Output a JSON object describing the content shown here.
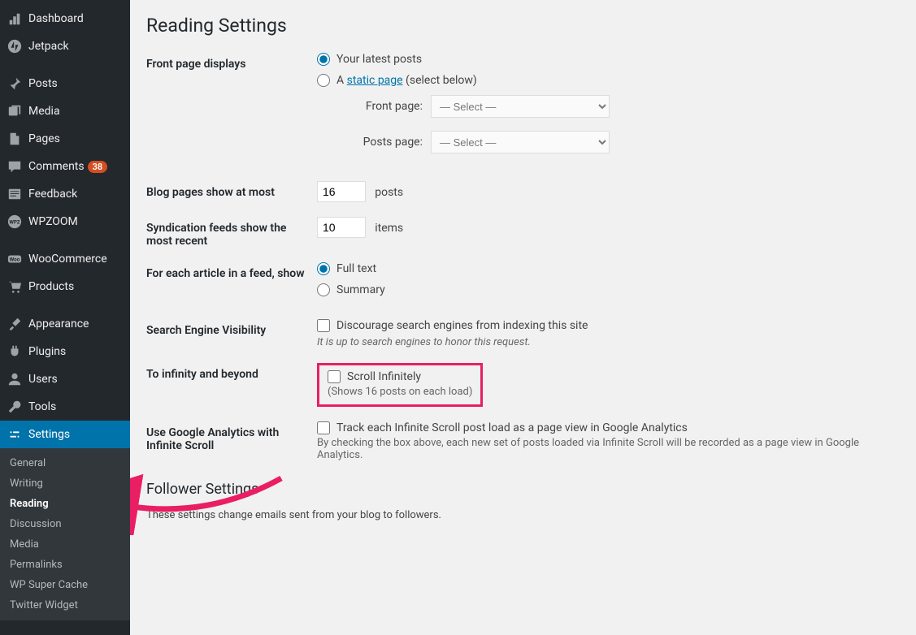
{
  "sidebar": {
    "dashboard": "Dashboard",
    "jetpack": "Jetpack",
    "posts": "Posts",
    "media": "Media",
    "pages": "Pages",
    "comments": "Comments",
    "comments_badge": "38",
    "feedback": "Feedback",
    "wpzoom": "WPZOOM",
    "woocommerce": "WooCommerce",
    "products": "Products",
    "appearance": "Appearance",
    "plugins": "Plugins",
    "users": "Users",
    "tools": "Tools",
    "settings": "Settings"
  },
  "submenu": {
    "general": "General",
    "writing": "Writing",
    "reading": "Reading",
    "discussion": "Discussion",
    "media": "Media",
    "permalinks": "Permalinks",
    "wpsupercache": "WP Super Cache",
    "twitterwidget": "Twitter Widget"
  },
  "page": {
    "title": "Reading Settings",
    "front_page_displays_label": "Front page displays",
    "your_latest_posts": "Your latest posts",
    "a_prefix": "A ",
    "static_page_link": "static page",
    "select_below": " (select below)",
    "front_page_label": "Front page:",
    "posts_page_label": "Posts page:",
    "select_placeholder": "— Select —",
    "blog_pages_label": "Blog pages show at most",
    "blog_pages_value": "16",
    "posts_suffix": "posts",
    "syndication_label": "Syndication feeds show the most recent",
    "syndication_value": "10",
    "items_suffix": "items",
    "feed_show_label": "For each article in a feed, show",
    "full_text": "Full text",
    "summary": "Summary",
    "sev_label": "Search Engine Visibility",
    "sev_checkbox": "Discourage search engines from indexing this site",
    "sev_desc": "It is up to search engines to honor this request.",
    "infinity_label": "To infinity and beyond",
    "scroll_infinitely": "Scroll Infinitely",
    "scroll_desc": "(Shows 16 posts on each load)",
    "ga_label": "Use Google Analytics with Infinite Scroll",
    "ga_checkbox": "Track each Infinite Scroll post load as a page view in Google Analytics",
    "ga_desc": "By checking the box above, each new set of posts loaded via Infinite Scroll will be recorded as a page view in Google Analytics.",
    "follower_heading": "Follower Settings",
    "follower_desc": "These settings change emails sent from your blog to followers."
  }
}
